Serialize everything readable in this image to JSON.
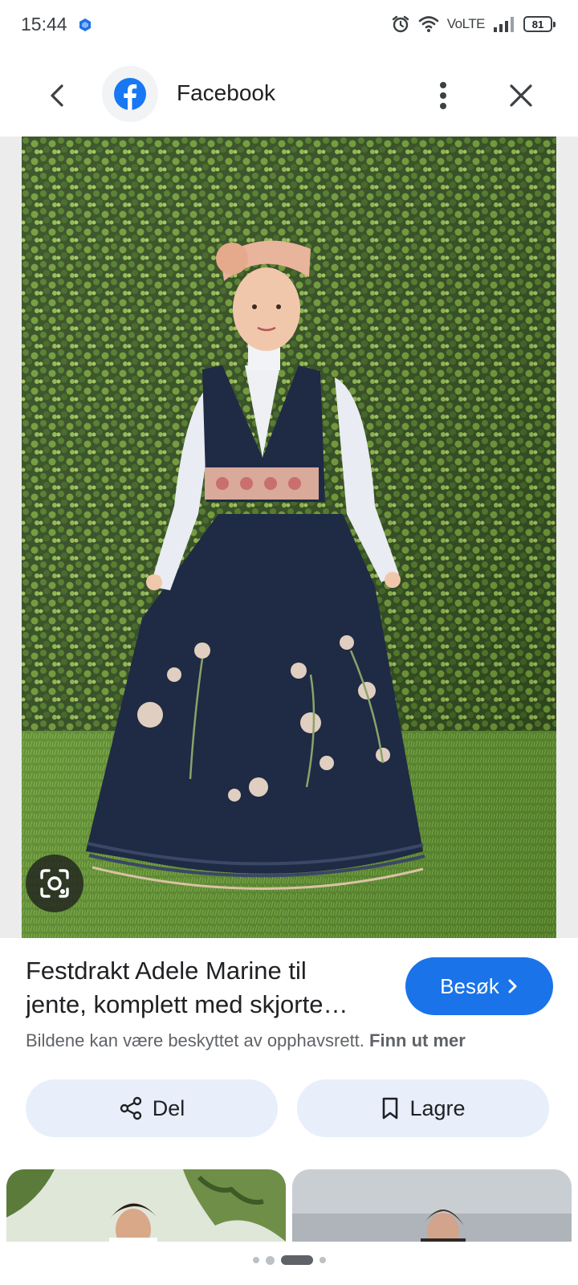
{
  "status_bar": {
    "time": "15:44",
    "network": "VoLTE",
    "battery": "81",
    "icons": [
      "alarm-icon",
      "wifi-icon",
      "signal-icon",
      "battery-icon"
    ]
  },
  "top_bar": {
    "source_title": "Facebook",
    "icons": [
      "back-arrow-icon",
      "facebook-logo-icon",
      "more-vert-icon",
      "close-icon"
    ]
  },
  "image_viewer": {
    "photo_subject": "photo-girl-in-bunad",
    "lens_icon": "google-lens-icon"
  },
  "caption": {
    "title_line1": "Festdrakt Adele Marine til",
    "title_line2": "jente, komplett med skjorte…",
    "visit_label": "Besøk",
    "copyright_text": "Bildene kan være beskyttet av opphavsrett.",
    "learn_more_link": "Finn ut mer"
  },
  "actions": {
    "share_label": "Del",
    "save_label": "Lagre"
  },
  "colors": {
    "accent": "#1a73e8",
    "action_bg": "#e8effb",
    "text_primary": "#202124",
    "text_secondary": "#5f6368"
  },
  "pager": {
    "page_count": 4,
    "active_page": 3
  }
}
